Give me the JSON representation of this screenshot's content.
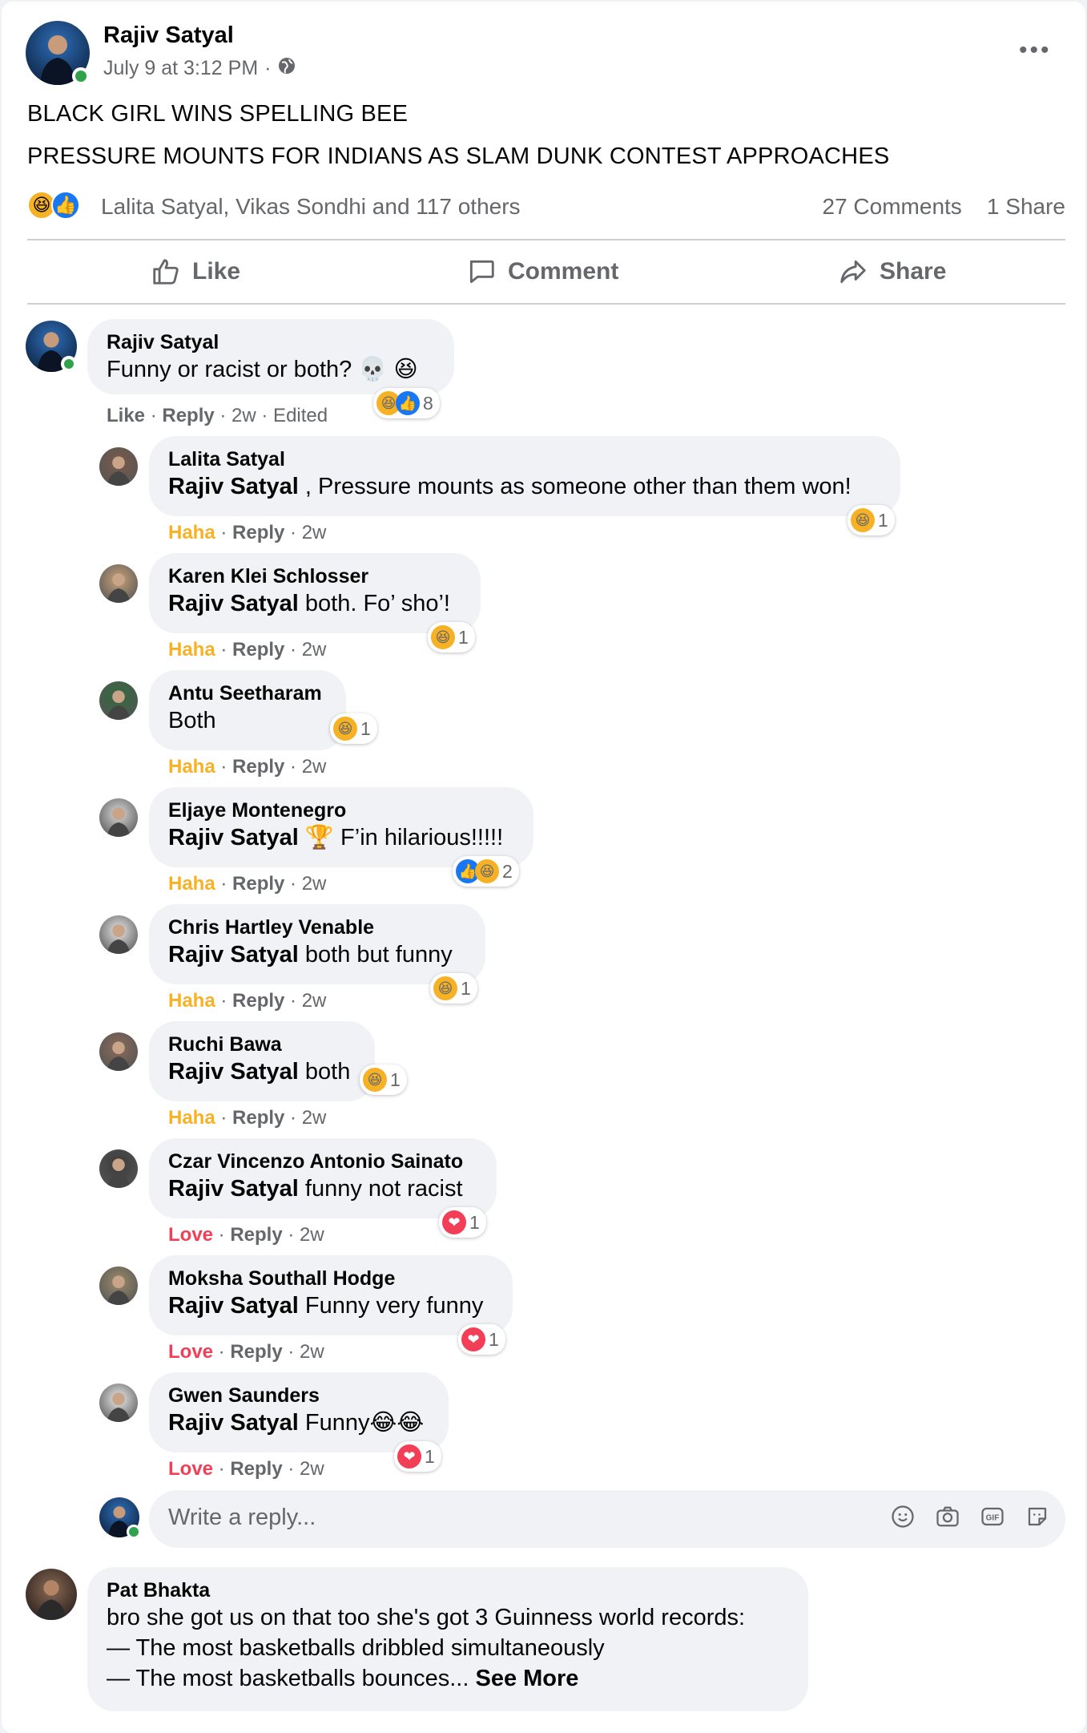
{
  "post": {
    "author": "Rajiv Satyal",
    "timestamp": "July 9 at 3:12 PM",
    "separator": "·",
    "privacy_icon": "globe-icon",
    "lines": [
      "BLACK GIRL WINS SPELLING BEE",
      "PRESSURE MOUNTS FOR INDIANS AS SLAM DUNK CONTEST APPROACHES"
    ],
    "reaction_names": "Lalita Satyal, Vikas Sondhi and 117 others",
    "comments_count": "27 Comments",
    "shares_count": "1 Share",
    "reaction_types": [
      "haha",
      "like"
    ]
  },
  "actions": {
    "like": "Like",
    "comment": "Comment",
    "share": "Share"
  },
  "comments": [
    {
      "name": "Rajiv Satyal",
      "text": "Funny or racist or both? 💀 😆",
      "meta_a": "Like",
      "meta_b": "Reply",
      "meta_c": "2w · Edited",
      "reaction_count": "8"
    }
  ],
  "replies": [
    {
      "name": "Lalita Satyal",
      "mention": "Rajiv Satyal",
      "text": " , Pressure mounts as someone other than them won!",
      "reaction": "Haha",
      "reply": "Reply",
      "time": "2w",
      "count": "1"
    },
    {
      "name": "Karen Klei Schlosser",
      "mention": "Rajiv Satyal",
      "text": " both. Fo’ sho’!",
      "reaction": "Haha",
      "reply": "Reply",
      "time": "2w",
      "count": "1"
    },
    {
      "name": "Antu Seetharam",
      "mention": "",
      "text": "Both",
      "reaction": "Haha",
      "reply": "Reply",
      "time": "2w",
      "count": "1"
    },
    {
      "name": "Eljaye Montenegro",
      "mention": "Rajiv Satyal",
      "text": " 🏆 F’in hilarious!!!!!",
      "reaction": "Haha",
      "reply": "Reply",
      "time": "2w",
      "count": "2"
    },
    {
      "name": "Chris Hartley Venable",
      "mention": "Rajiv Satyal",
      "text": " both but funny",
      "reaction": "Haha",
      "reply": "Reply",
      "time": "2w",
      "count": "1"
    },
    {
      "name": "Ruchi Bawa",
      "mention": "Rajiv Satyal",
      "text": " both",
      "reaction": "Haha",
      "reply": "Reply",
      "time": "2w",
      "count": "1"
    },
    {
      "name": "Czar Vincenzo Antonio Sainato",
      "mention": "Rajiv Satyal",
      "text": " funny not racist",
      "reaction": "Love",
      "reply": "Reply",
      "time": "2w",
      "count": "1"
    },
    {
      "name": "Moksha Southall Hodge",
      "mention": "Rajiv Satyal",
      "text": " Funny very funny",
      "reaction": "Love",
      "reply": "Reply",
      "time": "2w",
      "count": "1"
    },
    {
      "name": "Gwen Saunders",
      "mention": "Rajiv Satyal",
      "text": " Funny😂😂",
      "reaction": "Love",
      "reply": "Reply",
      "time": "2w",
      "count": "1"
    }
  ],
  "reply_input": {
    "placeholder": "Write a reply..."
  },
  "last_comment": {
    "name": "Pat Bhakta",
    "line1": "bro she got us on that too she's got 3 Guinness world records:",
    "line2": "— The most basketballs dribbled simultaneously",
    "line3": "— The most basketballs bounces... ",
    "see_more": "See More"
  },
  "colors": {
    "haha": "#f7b125",
    "love": "#f33e58",
    "like": "#1877f2",
    "online": "#31a24c"
  }
}
